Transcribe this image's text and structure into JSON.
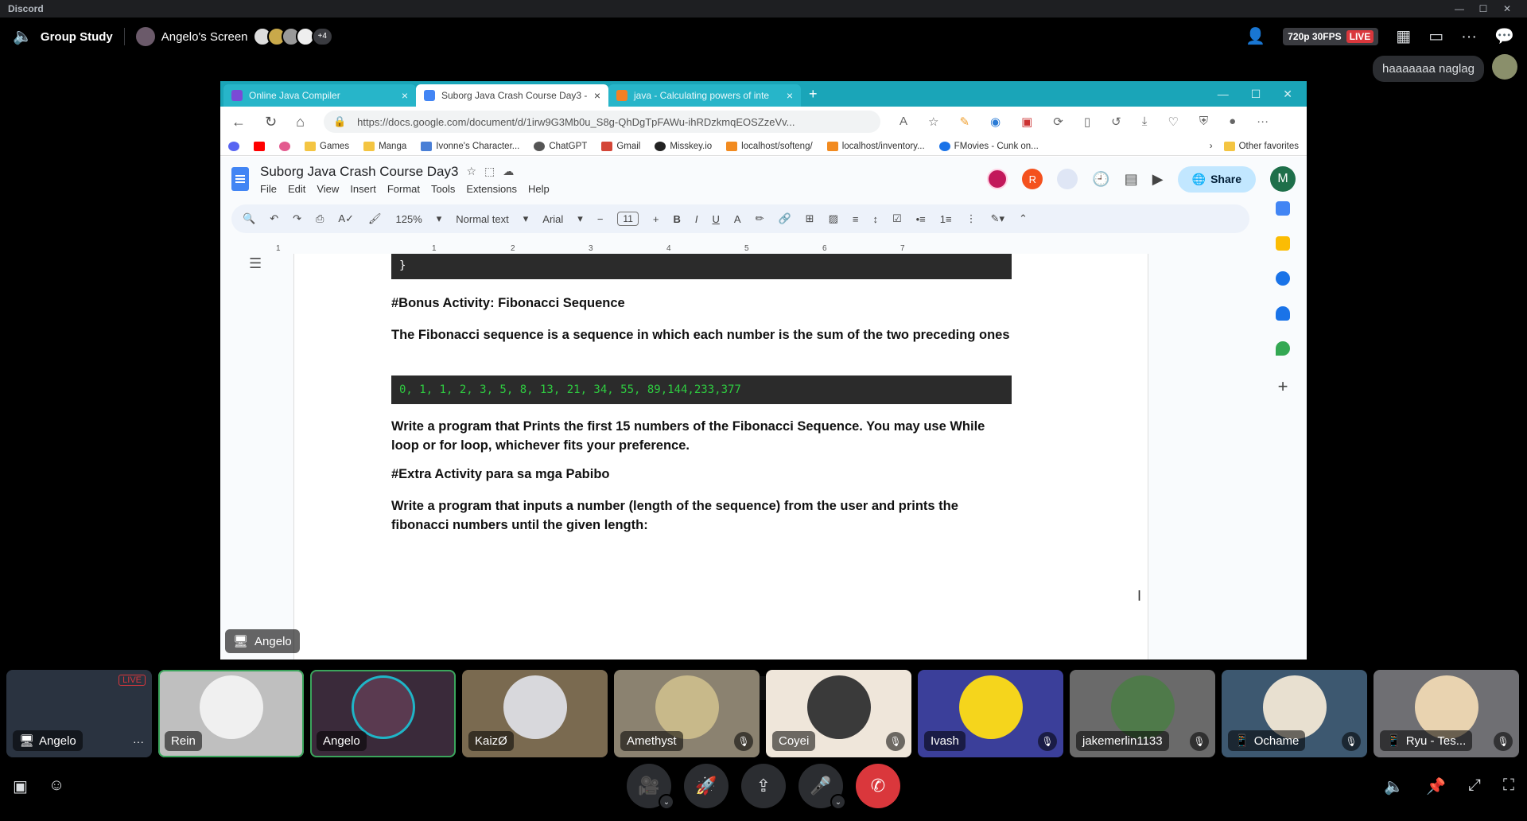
{
  "discord": {
    "app_name": "Discord",
    "channel_name": "Group Study",
    "screen_name": "Angelo's Screen",
    "extra_viewers": "+4",
    "quality": "720p 30FPS",
    "live": "LIVE",
    "chat_message": "haaaaaaa naglag"
  },
  "browser": {
    "tabs": [
      {
        "label": "Online Java Compiler",
        "active": false
      },
      {
        "label": "Suborg Java Crash Course Day3 -",
        "active": true
      },
      {
        "label": "java - Calculating powers of inte",
        "active": false
      }
    ],
    "url": "https://docs.google.com/document/d/1irw9G3Mb0u_S8g-QhDgTpFAWu-ihRDzkmqEOSZzeVv...",
    "bookmarks": [
      "Games",
      "Manga",
      "Ivonne's Character...",
      "ChatGPT",
      "Gmail",
      "Misskey.io",
      "localhost/softeng/",
      "localhost/inventory...",
      "FMovies - Cunk on..."
    ],
    "other_favorites": "Other favorites"
  },
  "doc": {
    "title": "Suborg Java Crash Course Day3",
    "menu": [
      "File",
      "Edit",
      "View",
      "Insert",
      "Format",
      "Tools",
      "Extensions",
      "Help"
    ],
    "share_label": "Share",
    "user_initial": "M",
    "collab_initial": "R",
    "toolbar": {
      "zoom": "125%",
      "style": "Normal text",
      "font": "Arial",
      "size": "11"
    },
    "ruler": [
      "1",
      "1",
      "2",
      "3",
      "4",
      "5",
      "6",
      "7"
    ],
    "code_close": "}",
    "bonus_heading": "#Bonus Activity: Fibonacci Sequence",
    "bonus_desc": "The Fibonacci sequence is a sequence in which each number is the sum of the two preceding ones",
    "sequence": "0, 1, 1, 2, 3, 5, 8, 13, 21, 34, 55, 89,144,233,377",
    "task1": "Write a program that Prints the first 15 numbers of the Fibonacci Sequence. You may use While loop or for loop, whichever fits your preference.",
    "extra_heading": "#Extra Activity para sa mga Pabibo",
    "task2": "Write a program that inputs a number (length of the sequence) from the user and prints the fibonacci numbers until the given length:"
  },
  "stream_label": "Angelo",
  "participants": [
    {
      "name": "Angelo",
      "color": "#2a3340"
    },
    {
      "name": "Rein",
      "color": "#bfbfbf"
    },
    {
      "name": "Angelo",
      "color": "#3a2a3a"
    },
    {
      "name": "KaizØ",
      "color": "#7a6a50"
    },
    {
      "name": "Amethyst",
      "color": "#8b8270"
    },
    {
      "name": "Coyei",
      "color": "#efe6da"
    },
    {
      "name": "Ivash",
      "color": "#3b3f9a"
    },
    {
      "name": "jakemerlin1133",
      "color": "#6a6a6a"
    },
    {
      "name": "Ochame",
      "color": "#3d5870"
    },
    {
      "name": "Ryu - Tes...",
      "color": "#6f6f73"
    }
  ],
  "colors": {
    "live": "#da373c",
    "speaking": "#3ba55c",
    "tabbar": "#1aa5b8",
    "leave": "#da373c"
  }
}
